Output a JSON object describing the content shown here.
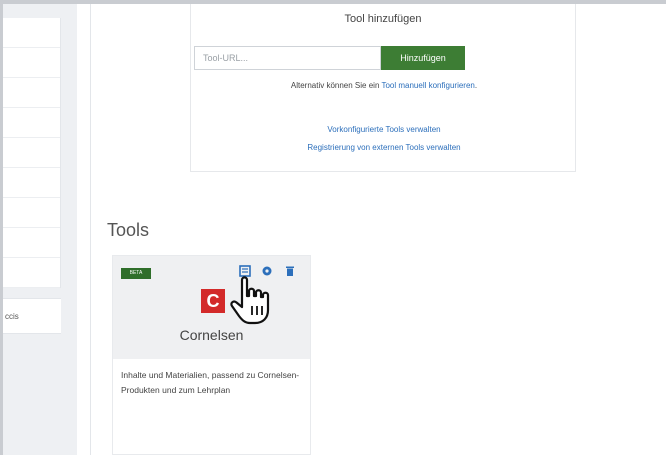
{
  "sidebar": {
    "items": [
      "",
      "",
      "",
      "",
      "",
      "",
      "",
      "",
      ""
    ],
    "footer_fragment": "ccis"
  },
  "add_tool": {
    "title": "Tool hinzufügen",
    "url_placeholder": "Tool-URL...",
    "add_button": "Hinzufügen",
    "alternative_prefix": "Alternativ können Sie ein ",
    "alternative_link": "Tool manuell konfigurieren",
    "alternative_suffix": ".",
    "manage_link": "Vorkonfigurierte Tools verwalten",
    "registration_link": "Registrierung von externen Tools verwalten"
  },
  "tools": {
    "heading": "Tools",
    "cards": [
      {
        "badge": "BETA",
        "logo_letter": "C",
        "name": "Cornelsen",
        "description": "Inhalte und Materialien, passend zu Cornelsen-Produkten und zum Lehrplan"
      }
    ]
  },
  "colors": {
    "accent_green": "#3d7d34",
    "link_blue": "#2c6fbb",
    "brand_red": "#d32a2a"
  },
  "icons": {
    "edit": "edit-icon",
    "config": "gear-icon",
    "delete": "trash-icon",
    "cursor": "hand-pointer-icon"
  }
}
